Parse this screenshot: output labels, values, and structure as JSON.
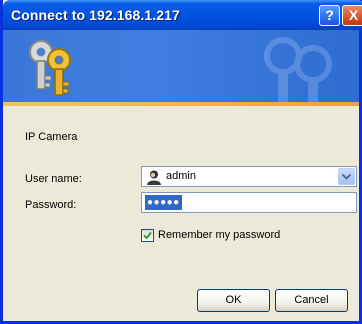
{
  "window": {
    "title": "Connect to 192.168.1.217",
    "help_label": "?",
    "close_label": "X"
  },
  "form": {
    "device_name": "IP Camera",
    "username_label": "User name:",
    "username_value": "admin",
    "password_label": "Password:",
    "password_mask": "●●●●●",
    "remember_label": "Remember my password",
    "remember_checked": true
  },
  "buttons": {
    "ok_label": "OK",
    "cancel_label": "Cancel"
  },
  "colors": {
    "titlebar": "#0054e3",
    "banner": "#3f7fe0",
    "dialog_bg": "#ece9d8",
    "selection": "#316ac5"
  },
  "icons": {
    "banner": "keys-icon",
    "user": "user-icon",
    "combo": "chevron-down-icon",
    "checkbox": "checkmark-icon"
  }
}
